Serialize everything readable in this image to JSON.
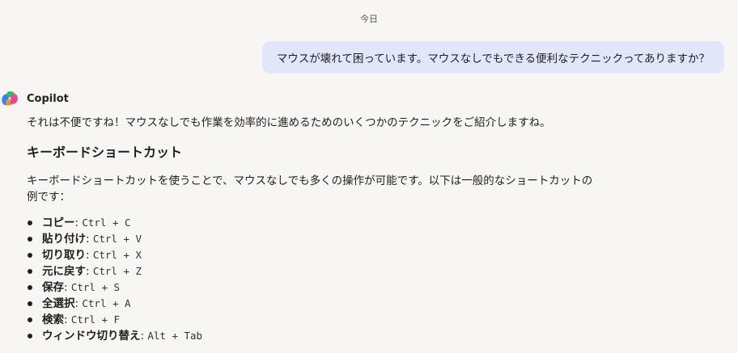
{
  "date_label": "今日",
  "user_message": "マウスが壊れて困っています。マウスなしでもできる便利なテクニックってありますか？",
  "assistant": {
    "name": "Copilot",
    "intro": "それは不便ですね！マウスなしでも作業を効率的に進めるためのいくつかのテクニックをご紹介しますね。",
    "section_title": "キーボードショートカット",
    "section_desc": "キーボードショートカットを使うことで、マウスなしでも多くの操作が可能です。以下は一般的なショートカットの例です：",
    "shortcuts": [
      {
        "label": "コピー",
        "keys": "Ctrl + C"
      },
      {
        "label": "貼り付け",
        "keys": "Ctrl + V"
      },
      {
        "label": "切り取り",
        "keys": "Ctrl + X"
      },
      {
        "label": "元に戻す",
        "keys": "Ctrl + Z"
      },
      {
        "label": "保存",
        "keys": "Ctrl + S"
      },
      {
        "label": "全選択",
        "keys": "Ctrl + A"
      },
      {
        "label": "検索",
        "keys": "Ctrl + F"
      },
      {
        "label": "ウィンドウ切り替え",
        "keys": "Alt + Tab"
      }
    ]
  },
  "colors": {
    "background": "#f7f6f4",
    "user_bubble": "#e1e6fb",
    "text": "#1f1f1f"
  },
  "icons": {
    "assistant_logo": "copilot-logo-icon"
  }
}
